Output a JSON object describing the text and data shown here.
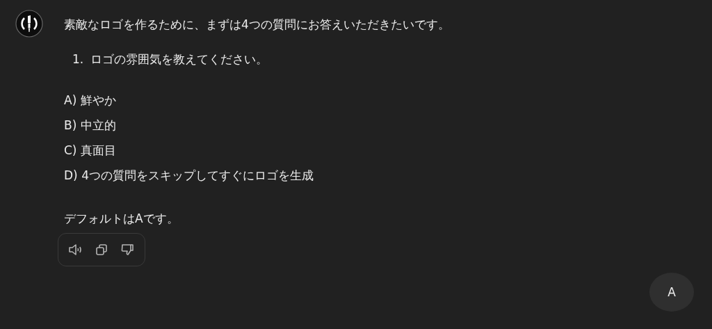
{
  "message": {
    "intro": "素敵なロゴを作るために、まずは4つの質問にお答えいただきたいです。",
    "question": {
      "number": "1.",
      "text": "ロゴの雰囲気を教えてください。"
    },
    "options": [
      "A) 鮮やか",
      "B) 中立的",
      "C) 真面目",
      "D) 4つの質問をスキップしてすぐにロゴを生成"
    ],
    "footer": "デフォルトはAです。"
  },
  "user_avatar": {
    "label": "A"
  }
}
